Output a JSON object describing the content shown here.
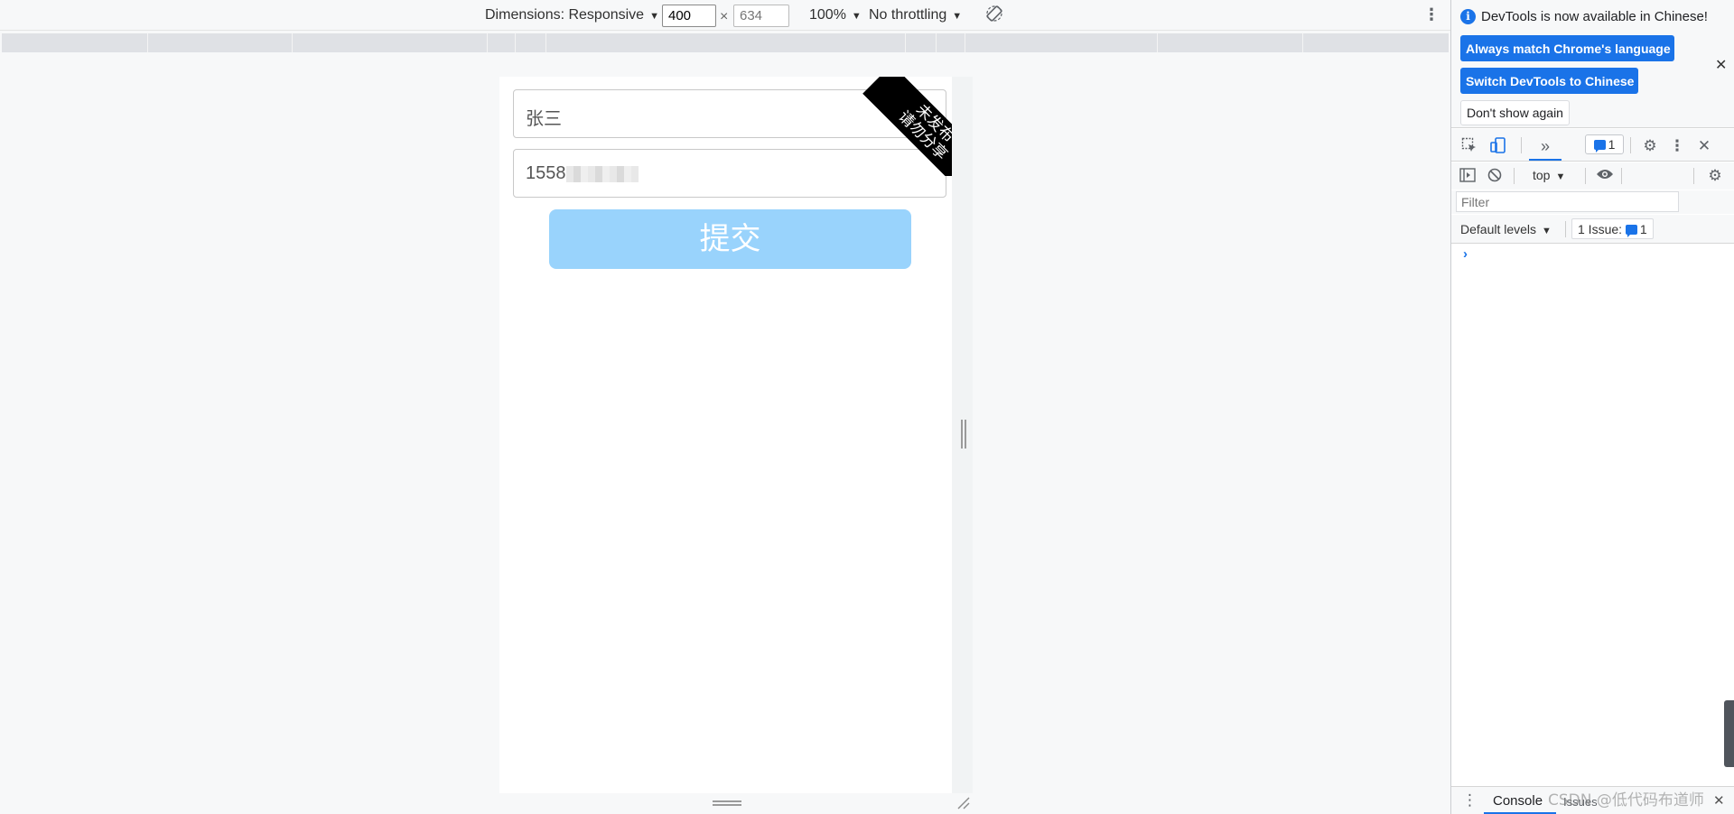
{
  "device_toolbar": {
    "dimensions_label": "Dimensions: Responsive",
    "width_value": "400",
    "times_symbol": "×",
    "height_placeholder": "634",
    "zoom_label": "100%",
    "throttling_label": "No throttling",
    "more_menu_icon": "more-vert-icon",
    "rotate_icon": "rotate-device-icon"
  },
  "page": {
    "name_value": "张三",
    "phone_value": "1558",
    "phone_masked": true,
    "submit_label": "提交",
    "submit_color": "#99d3fc",
    "ribbon_line1": "未发布",
    "ribbon_line2": "请勿分享"
  },
  "devtools": {
    "info_icon": "info-icon",
    "info_message": "DevTools is now available in Chinese!",
    "always_match_label": "Always match Chrome's language",
    "switch_label": "Switch DevTools to Chinese",
    "dont_show_label": "Don't show again",
    "close_icon": "close-icon",
    "issues_badge_count": "1",
    "context_label": "top",
    "filter_placeholder": "Filter",
    "levels_label": "Default levels",
    "issue_count_label": "1 Issue:",
    "issue_count_value": "1",
    "prompt_symbol": "›",
    "drawer_console_label": "Console",
    "drawer_issues_label": "Issues",
    "accent_color": "#1a73e8"
  },
  "watermark": "CSDN @低代码布道师"
}
